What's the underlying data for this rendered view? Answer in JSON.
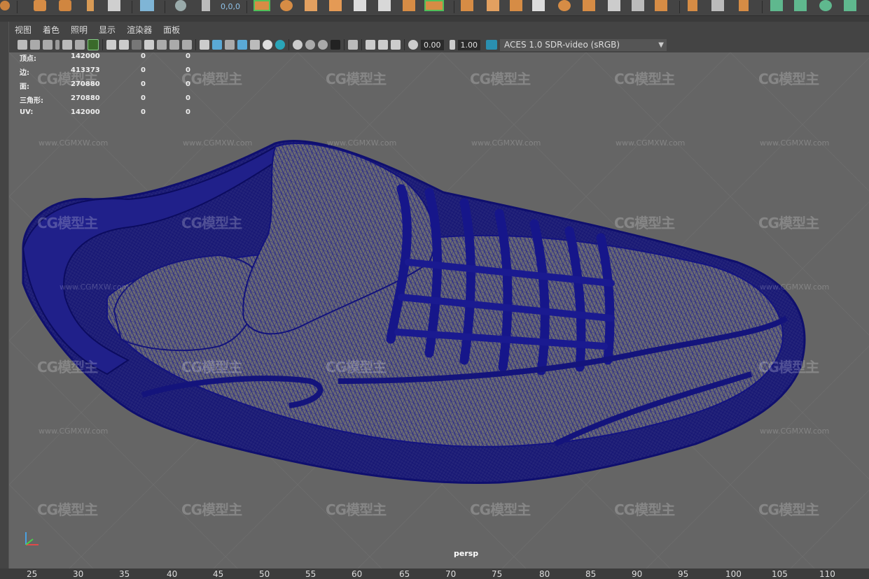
{
  "menu": {
    "items": [
      "视图",
      "着色",
      "照明",
      "显示",
      "渲染器",
      "面板"
    ]
  },
  "shelf": {
    "coord_readout": "0,0,0"
  },
  "toolbar": {
    "exposure": "0.00",
    "gamma": "1.00",
    "color_space": "ACES 1.0 SDR-video (sRGB)"
  },
  "hud": {
    "rows": [
      {
        "label": "顶点:",
        "v1": "142000",
        "v2": "0",
        "v3": "0"
      },
      {
        "label": "边:",
        "v1": "413373",
        "v2": "0",
        "v3": "0"
      },
      {
        "label": "面:",
        "v1": "270880",
        "v2": "0",
        "v3": "0"
      },
      {
        "label": "三角形:",
        "v1": "270880",
        "v2": "0",
        "v3": "0"
      },
      {
        "label": "UV:",
        "v1": "142000",
        "v2": "0",
        "v3": "0"
      }
    ]
  },
  "camera_label": "persp",
  "watermark": {
    "logo_text": "CG模型主",
    "url": "www.CGMXW.com"
  },
  "timeline": {
    "ticks": [
      "25",
      "30",
      "35",
      "40",
      "45",
      "50",
      "55",
      "60",
      "65",
      "70",
      "75",
      "80",
      "85",
      "90",
      "95",
      "100",
      "105",
      "110"
    ]
  },
  "colors": {
    "wire": "#1a1a8c",
    "viewport_bg": "#656565",
    "accent": "#e8a15a"
  }
}
